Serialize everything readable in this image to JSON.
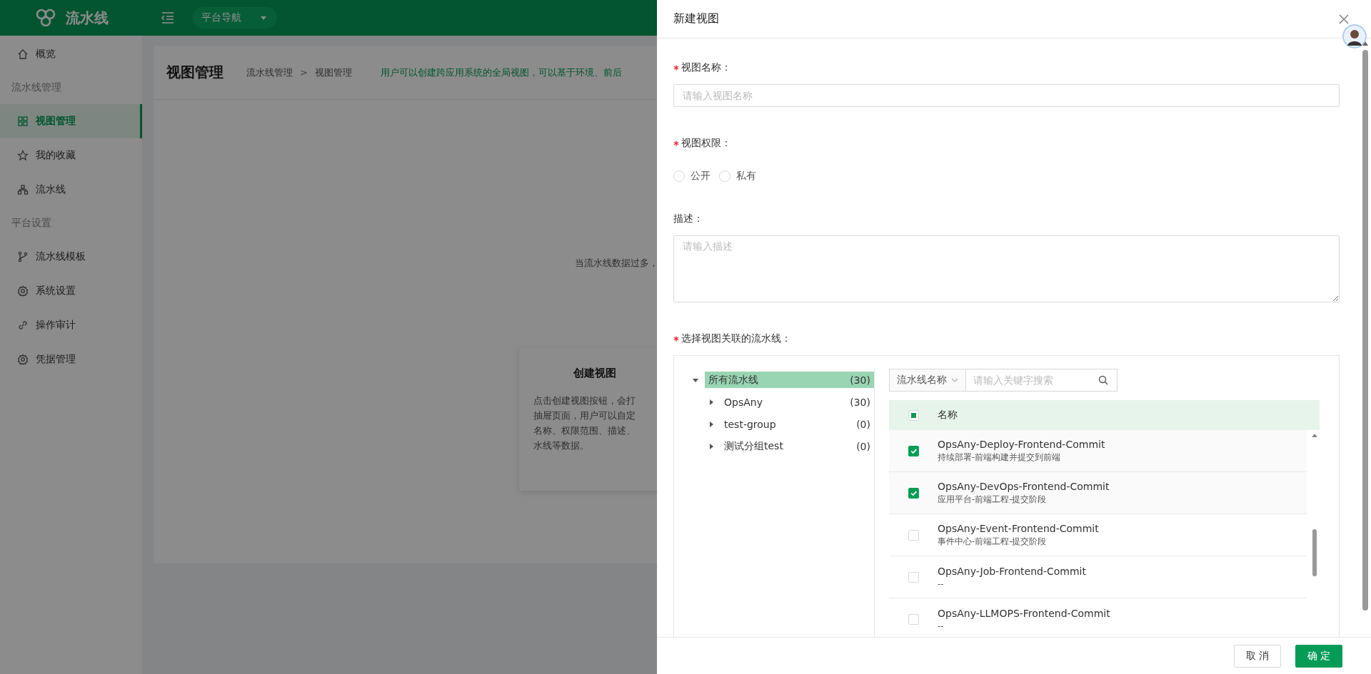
{
  "header": {
    "logo": "流水线",
    "nav": "平台导航"
  },
  "sidebar": {
    "groups": [
      {
        "items": [
          {
            "label": "概览",
            "selected": false
          }
        ]
      },
      {
        "title": "流水线管理",
        "items": [
          {
            "label": "视图管理",
            "selected": true
          },
          {
            "label": "我的收藏",
            "selected": false
          },
          {
            "label": "流水线",
            "selected": false
          }
        ]
      },
      {
        "title": "平台设置",
        "items": [
          {
            "label": "流水线模板",
            "selected": false
          },
          {
            "label": "系统设置",
            "selected": false
          },
          {
            "label": "操作审计",
            "selected": false
          },
          {
            "label": "凭据管理",
            "selected": false
          }
        ]
      }
    ]
  },
  "page": {
    "title": "视图管理",
    "breadcrumb": [
      "流水线管理",
      "视图管理"
    ],
    "breadcrumb_separator": ">",
    "description": "用户可以创建跨应用系统的全局视图，可以基于环境、前后",
    "empty_text": "当流水线数据过多，",
    "card": {
      "title": "创建视图",
      "lines": [
        "点击创建视图按钮，会打",
        "抽屉页面，用户可以自定",
        "名称、权限范围、描述、",
        "水线等数据。"
      ]
    }
  },
  "drawer": {
    "title": "新建视图",
    "fields": [
      {
        "kind": "input",
        "label": "视图名称：",
        "required": true,
        "placeholder": "请输入视图名称"
      },
      {
        "kind": "radio",
        "label": "视图权限：",
        "required": true,
        "options": [
          {
            "label": "公开",
            "selected": false
          },
          {
            "label": "私有",
            "selected": false
          }
        ]
      },
      {
        "kind": "textarea",
        "label": "描述：",
        "required": false,
        "placeholder": "请输入描述"
      },
      {
        "kind": "transfer",
        "label": "选择视图关联的流水线：",
        "required": true,
        "tree": [
          {
            "label": "所有流水线",
            "count": "(30)",
            "expanded": true,
            "selected": true,
            "children": [
              {
                "label": "OpsAny",
                "count": "(30)",
                "expanded": false,
                "selected": false
              },
              {
                "label": "test-group",
                "count": "(0)",
                "expanded": false,
                "selected": false
              },
              {
                "label": "测试分组test",
                "count": "(0)",
                "expanded": false,
                "selected": false
              }
            ]
          }
        ],
        "filter": {
          "field": "流水线名称",
          "placeholder": "请输入关键字搜索"
        },
        "table": {
          "select_all": {
            "indeterminate": true
          },
          "column": "名称",
          "rows": [
            {
              "name": "OpsAny-Deploy-Frontend-Commit",
              "desc": "持续部署-前端构建并提交到前端",
              "checked": true
            },
            {
              "name": "OpsAny-DevOps-Frontend-Commit",
              "desc": "应用平台-前端工程-提交阶段",
              "checked": true
            },
            {
              "name": "OpsAny-Event-Frontend-Commit",
              "desc": "事件中心-前端工程-提交阶段",
              "checked": false
            },
            {
              "name": "OpsAny-Job-Frontend-Commit",
              "desc": "--",
              "checked": false
            },
            {
              "name": "OpsAny-LLMOPS-Frontend-Commit",
              "desc": "--",
              "checked": false
            }
          ]
        }
      }
    ],
    "buttons": [
      {
        "label": "取 消",
        "kind": "default"
      },
      {
        "label": "确 定",
        "kind": "primary"
      }
    ]
  }
}
